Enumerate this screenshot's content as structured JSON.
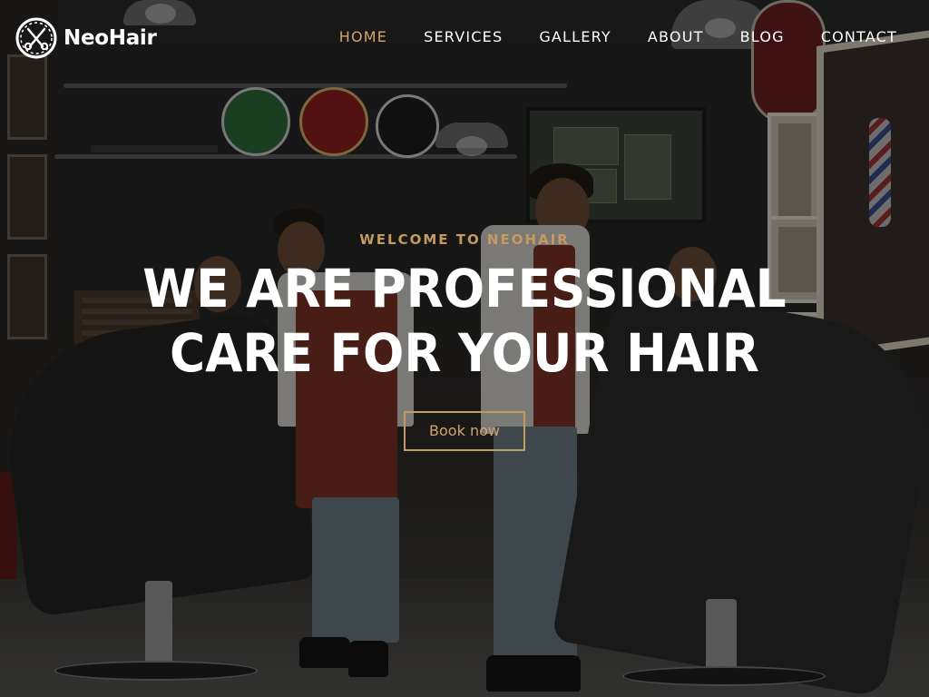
{
  "brand": {
    "name": "NeoHair",
    "logo_icon": "scissors-gear-icon"
  },
  "nav": {
    "items": [
      {
        "label": "HOME",
        "active": true
      },
      {
        "label": "SERVICES",
        "active": false
      },
      {
        "label": "GALLERY",
        "active": false
      },
      {
        "label": "ABOUT",
        "active": false
      },
      {
        "label": "BLOG",
        "active": false
      },
      {
        "label": "CONTACT",
        "active": false
      }
    ]
  },
  "hero": {
    "eyebrow": "WELCOME TO NEOHAIR",
    "headline": "WE ARE PROFESSIONAL CARE FOR YOUR HAIR",
    "cta_label": "Book now"
  },
  "colors": {
    "accent": "#c49a5f",
    "nav_active": "#d3a569",
    "text": "#ffffff",
    "overlay": "rgba(0,0,0,0.42)"
  }
}
